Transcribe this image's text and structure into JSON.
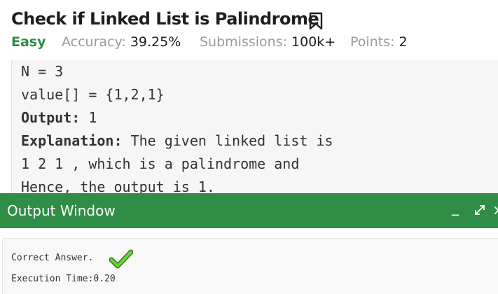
{
  "problem": {
    "title": "Check if Linked List is Palindrome",
    "difficulty": "Easy",
    "accuracy_label": "Accuracy:",
    "accuracy_value": "39.25%",
    "submissions_label": "Submissions:",
    "submissions_value": "100k+",
    "points_label": "Points:",
    "points_value": "2",
    "bookmark_icon": "bookmark-icon"
  },
  "example": {
    "line1": "N = 3",
    "line2": "value[] = {1,2,1}",
    "output_label": "Output:",
    "output_value": " 1",
    "explanation_label": "Explanation:",
    "explanation_line1": " The given linked list is",
    "explanation_line2": "1 2 1 , which is a palindrome and",
    "explanation_line3": "Hence, the output is 1."
  },
  "output_window": {
    "title": "Output Window",
    "minimize_symbol": "_",
    "close_symbol": "×",
    "result_text": "Correct Answer.",
    "execution_text": "Execution Time:0.20",
    "accent_color": "#2f8d46",
    "check_color": "#4caf1e"
  }
}
